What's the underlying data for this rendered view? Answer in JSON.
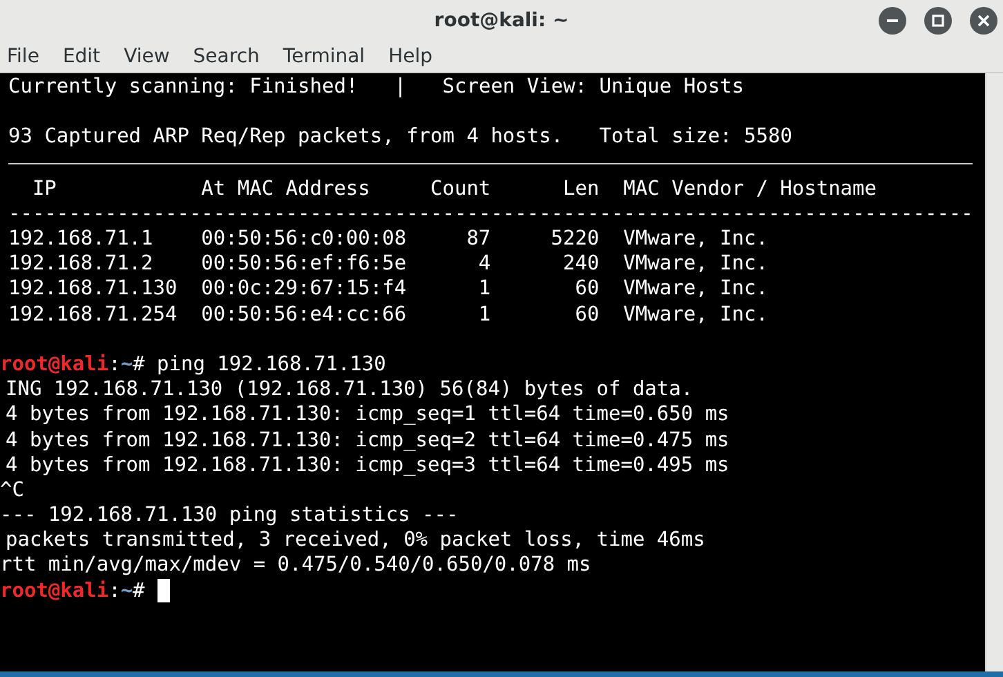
{
  "window": {
    "title": "root@kali: ~"
  },
  "menu": [
    "File",
    "Edit",
    "View",
    "Search",
    "Terminal",
    "Help"
  ],
  "scan": {
    "status_lines": [
      "Currently scanning: Finished!   |   Screen View: Unique Hosts",
      "93 Captured ARP Req/Rep packets, from 4 hosts.   Total size: 5580"
    ],
    "columns": [
      "IP",
      "At MAC Address",
      "Count",
      "Len",
      "MAC Vendor / Hostname"
    ],
    "separator": "--------------------------------------------------------------------------------",
    "rows": [
      {
        "ip": "192.168.71.1",
        "mac": "00:50:56:c0:00:08",
        "count": "87",
        "len": "5220",
        "vendor": "VMware, Inc."
      },
      {
        "ip": "192.168.71.2",
        "mac": "00:50:56:ef:f6:5e",
        "count": "4",
        "len": "240",
        "vendor": "VMware, Inc."
      },
      {
        "ip": "192.168.71.130",
        "mac": "00:0c:29:67:15:f4",
        "count": "1",
        "len": "60",
        "vendor": "VMware, Inc."
      },
      {
        "ip": "192.168.71.254",
        "mac": "00:50:56:e4:cc:66",
        "count": "1",
        "len": "60",
        "vendor": "VMware, Inc."
      }
    ]
  },
  "shell": [
    {
      "kind": "prompt",
      "user": "root@kali",
      "sep": ":",
      "path": "~",
      "command": "# ping 192.168.71.130"
    },
    {
      "kind": "cut",
      "text": "ING 192.168.71.130 (192.168.71.130) 56(84) bytes of data."
    },
    {
      "kind": "cut",
      "text": "4 bytes from 192.168.71.130: icmp_seq=1 ttl=64 time=0.650 ms"
    },
    {
      "kind": "cut",
      "text": "4 bytes from 192.168.71.130: icmp_seq=2 ttl=64 time=0.475 ms"
    },
    {
      "kind": "cut",
      "text": "4 bytes from 192.168.71.130: icmp_seq=3 ttl=64 time=0.495 ms"
    },
    {
      "kind": "text",
      "text": "^C"
    },
    {
      "kind": "text",
      "text": "--- 192.168.71.130 ping statistics ---"
    },
    {
      "kind": "cut",
      "text": "packets transmitted, 3 received, 0% packet loss, time 46ms"
    },
    {
      "kind": "text",
      "text": "rtt min/avg/max/mdev = 0.475/0.540/0.650/0.078 ms"
    },
    {
      "kind": "prompt",
      "user": "root@kali",
      "sep": ":",
      "path": "~",
      "command": "#",
      "cursor": true
    }
  ]
}
